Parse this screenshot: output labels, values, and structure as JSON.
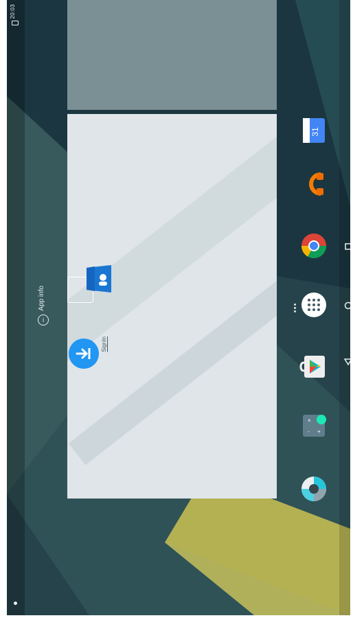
{
  "status_bar": {
    "time": "20:03"
  },
  "app_info": {
    "label": "App info"
  },
  "widgets": {
    "signin_label": "SignIn"
  },
  "dock": {
    "items": [
      {
        "name": "calendar",
        "icon": "calendar-icon",
        "text": "31"
      },
      {
        "name": "headphones-app",
        "icon": "headphones-icon"
      },
      {
        "name": "chrome",
        "icon": "chrome-icon"
      },
      {
        "name": "app-drawer",
        "icon": "app-drawer-icon"
      },
      {
        "name": "play-store",
        "icon": "play-store-icon"
      },
      {
        "name": "calculator",
        "icon": "calculator-icon"
      },
      {
        "name": "photos-app",
        "icon": "photos-icon"
      }
    ]
  },
  "colors": {
    "wallpaper_dark": "#1f3b44",
    "wallpaper_teal": "#2f5257",
    "widget_panel": "#dfe5e8",
    "accent_blue": "#2196f3"
  }
}
